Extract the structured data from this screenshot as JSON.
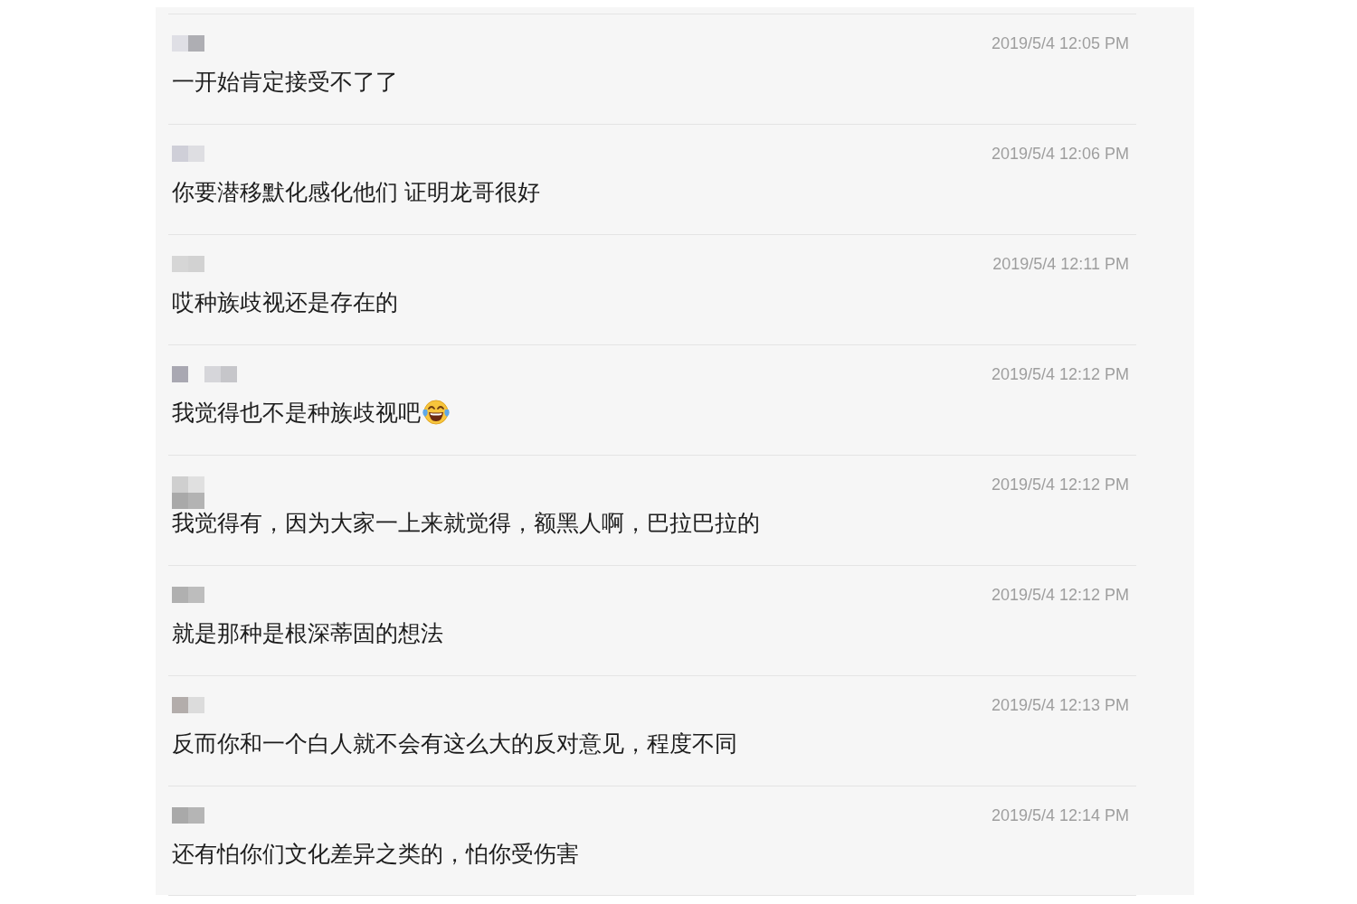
{
  "chat_log": {
    "messages": [
      {
        "time": "2019/5/4 12:05 PM",
        "text": "一开始肯定接受不了了",
        "laughing_emoji": false
      },
      {
        "time": "2019/5/4 12:06 PM",
        "text": "你要潜移默化感化他们 证明龙哥很好",
        "laughing_emoji": false
      },
      {
        "time": "2019/5/4 12:11 PM",
        "text": "哎种族歧视还是存在的",
        "laughing_emoji": false
      },
      {
        "time": "2019/5/4 12:12 PM",
        "text": "我觉得也不是种族歧视吧",
        "laughing_emoji": true
      },
      {
        "time": "2019/5/4 12:12 PM",
        "text": "我觉得有，因为大家一上来就觉得，额黑人啊，巴拉巴拉的",
        "laughing_emoji": false
      },
      {
        "time": "2019/5/4 12:12 PM",
        "text": "就是那种是根深蒂固的想法",
        "laughing_emoji": false
      },
      {
        "time": "2019/5/4 12:13 PM",
        "text": "反而你和一个白人就不会有这么大的反对意见，程度不同",
        "laughing_emoji": false
      },
      {
        "time": "2019/5/4 12:14 PM",
        "text": "还有怕你们文化差异之类的，怕你受伤害",
        "laughing_emoji": false
      }
    ]
  }
}
